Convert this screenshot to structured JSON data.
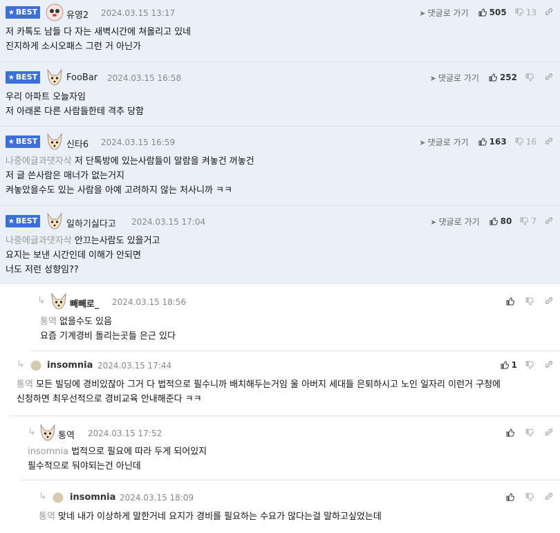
{
  "best_label": "BEST",
  "goto_label": "댓글로 가기",
  "comments": [
    {
      "nick": "유영2",
      "date": "2024.03.15 13:17",
      "up": "505",
      "down": "13",
      "lines": [
        "저 카톡도 남들 다 자는 새벽시간에 쳐올리고 있네",
        "진지하게 소시오패스 그런 거 아닌가"
      ]
    },
    {
      "nick": "FooBar",
      "date": "2024.03.15 16:58",
      "up": "252",
      "down": "",
      "lines": [
        "우리 아파트 오늘자임",
        "저 아래론 다른 사람들한테 격추 당함"
      ]
    },
    {
      "nick": "신타6",
      "date": "2024.03.15 16:59",
      "up": "163",
      "down": "16",
      "quote": "나중에글과댓자삭",
      "lines": [
        " 저 단톡방에 있는사람들이 알람을 켜놓건 꺼놓건",
        "저 글 쓴사람은 매너가 없는거지",
        "켜놓았을수도 있는 사람을 아예 고려하지 않는 처사니까 ㅋㅋ"
      ]
    },
    {
      "nick": "일하기싫다고",
      "date": "2024.03.15 17:04",
      "up": "80",
      "down": "7",
      "quote": "나중에글과댓자삭",
      "lines": [
        " 안끄는사람도 있을거고",
        "요지는 보낸 시간인데 이해가 안되면",
        "너도 저런 성향임??"
      ]
    },
    {
      "nick": "빼빼로_",
      "date": "2024.03.15 18:56",
      "up": "",
      "down": "",
      "quote": "통역",
      "lines": [
        " 없을수도 있음",
        "요즘 기계경비 돌리는곳들 은근 있다"
      ]
    },
    {
      "nick": "insomnia",
      "date": "2024.03.15 17:44",
      "up": "1",
      "down": "",
      "quote": "통역",
      "lines": [
        " 모든 빌딩에 경비있잖아 그거 다 법적으로 필수니까 배치해두는거임 울 아버지 세대들 은퇴하시고 노인 일자리 이런거 구청에",
        "신청하면 최우선적으로 경비교육 안내해준다 ㅋㅋ"
      ]
    },
    {
      "nick": "통역",
      "date": "2024.03.15 17:52",
      "up": "",
      "down": "",
      "quote": "insomnia",
      "lines": [
        " 법적으로 필요에 따라 두게 되어있지",
        "필수적으로 둬야되는건 아닌데"
      ]
    },
    {
      "nick": "insomnia",
      "date": "2024.03.15 18:09",
      "up": "",
      "down": "",
      "quote": "통역",
      "lines": [
        " 맞네 내가 이상하게 말한거네 요지가 경비를 필요하는 수요가 많다는걸 말하고싶었는데"
      ]
    }
  ]
}
